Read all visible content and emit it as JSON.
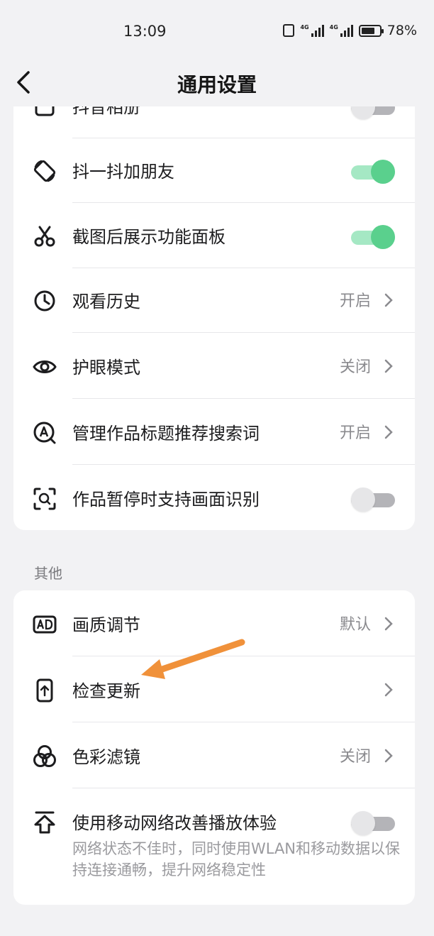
{
  "status_bar": {
    "time": "13:09",
    "battery": "78%",
    "battery_level": 0.78,
    "net_badge_1": "4G",
    "net_badge_2": "4G"
  },
  "header": {
    "title": "通用设置"
  },
  "card_general": {
    "partial_row": {
      "label": "抖音相册",
      "toggle": "off"
    },
    "rows": [
      {
        "label": "抖一抖加朋友",
        "toggle": "on",
        "icon": "rotate-screen-icon"
      },
      {
        "label": "截图后展示功能面板",
        "toggle": "on",
        "icon": "scissors-icon"
      },
      {
        "label": "观看历史",
        "value": "开启",
        "icon": "clock-icon"
      },
      {
        "label": "护眼模式",
        "value": "关闭",
        "icon": "eye-icon"
      },
      {
        "label": "管理作品标题推荐搜索词",
        "value": "开启",
        "icon": "search-a-icon"
      },
      {
        "label": "作品暂停时支持画面识别",
        "toggle": "off",
        "icon": "scan-icon"
      }
    ]
  },
  "section_other": {
    "title": "其他"
  },
  "card_other": {
    "rows": [
      {
        "label": "画质调节",
        "value": "默认",
        "icon": "ad-icon"
      },
      {
        "label": "检查更新",
        "value": "",
        "icon": "phone-update-icon"
      },
      {
        "label": "色彩滤镜",
        "value": "关闭",
        "icon": "color-filter-icon"
      },
      {
        "label": "使用移动网络改善播放体验",
        "toggle": "off",
        "icon": "upload-arrow-icon",
        "description": "网络状态不佳时，同时使用WLAN和移动数据以保持连接通畅，提升网络稳定性"
      }
    ]
  },
  "colors": {
    "toggle_on": "#5ad08d",
    "annotation_arrow": "#f0913a"
  }
}
